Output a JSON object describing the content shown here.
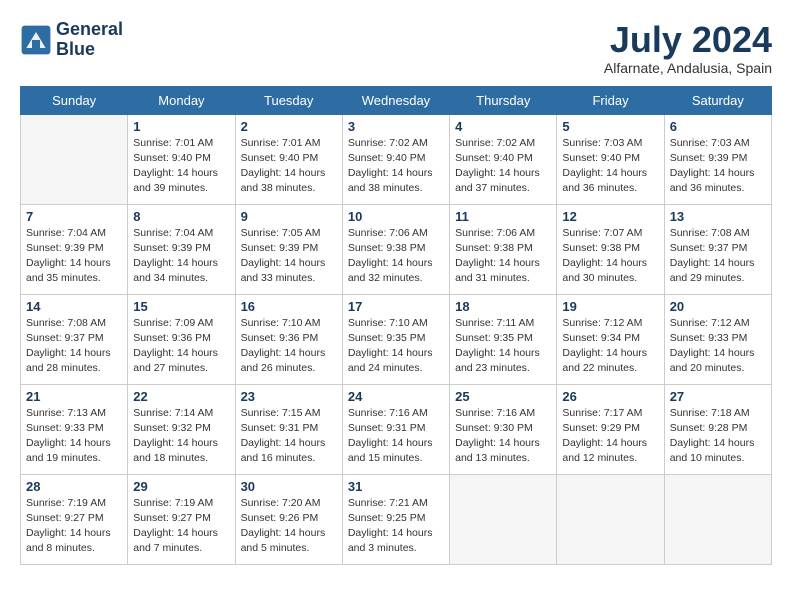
{
  "header": {
    "logo_line1": "General",
    "logo_line2": "Blue",
    "month_year": "July 2024",
    "location": "Alfarnate, Andalusia, Spain"
  },
  "days_of_week": [
    "Sunday",
    "Monday",
    "Tuesday",
    "Wednesday",
    "Thursday",
    "Friday",
    "Saturday"
  ],
  "weeks": [
    [
      {
        "day": "",
        "info": ""
      },
      {
        "day": "1",
        "info": "Sunrise: 7:01 AM\nSunset: 9:40 PM\nDaylight: 14 hours\nand 39 minutes."
      },
      {
        "day": "2",
        "info": "Sunrise: 7:01 AM\nSunset: 9:40 PM\nDaylight: 14 hours\nand 38 minutes."
      },
      {
        "day": "3",
        "info": "Sunrise: 7:02 AM\nSunset: 9:40 PM\nDaylight: 14 hours\nand 38 minutes."
      },
      {
        "day": "4",
        "info": "Sunrise: 7:02 AM\nSunset: 9:40 PM\nDaylight: 14 hours\nand 37 minutes."
      },
      {
        "day": "5",
        "info": "Sunrise: 7:03 AM\nSunset: 9:40 PM\nDaylight: 14 hours\nand 36 minutes."
      },
      {
        "day": "6",
        "info": "Sunrise: 7:03 AM\nSunset: 9:39 PM\nDaylight: 14 hours\nand 36 minutes."
      }
    ],
    [
      {
        "day": "7",
        "info": "Sunrise: 7:04 AM\nSunset: 9:39 PM\nDaylight: 14 hours\nand 35 minutes."
      },
      {
        "day": "8",
        "info": "Sunrise: 7:04 AM\nSunset: 9:39 PM\nDaylight: 14 hours\nand 34 minutes."
      },
      {
        "day": "9",
        "info": "Sunrise: 7:05 AM\nSunset: 9:39 PM\nDaylight: 14 hours\nand 33 minutes."
      },
      {
        "day": "10",
        "info": "Sunrise: 7:06 AM\nSunset: 9:38 PM\nDaylight: 14 hours\nand 32 minutes."
      },
      {
        "day": "11",
        "info": "Sunrise: 7:06 AM\nSunset: 9:38 PM\nDaylight: 14 hours\nand 31 minutes."
      },
      {
        "day": "12",
        "info": "Sunrise: 7:07 AM\nSunset: 9:38 PM\nDaylight: 14 hours\nand 30 minutes."
      },
      {
        "day": "13",
        "info": "Sunrise: 7:08 AM\nSunset: 9:37 PM\nDaylight: 14 hours\nand 29 minutes."
      }
    ],
    [
      {
        "day": "14",
        "info": "Sunrise: 7:08 AM\nSunset: 9:37 PM\nDaylight: 14 hours\nand 28 minutes."
      },
      {
        "day": "15",
        "info": "Sunrise: 7:09 AM\nSunset: 9:36 PM\nDaylight: 14 hours\nand 27 minutes."
      },
      {
        "day": "16",
        "info": "Sunrise: 7:10 AM\nSunset: 9:36 PM\nDaylight: 14 hours\nand 26 minutes."
      },
      {
        "day": "17",
        "info": "Sunrise: 7:10 AM\nSunset: 9:35 PM\nDaylight: 14 hours\nand 24 minutes."
      },
      {
        "day": "18",
        "info": "Sunrise: 7:11 AM\nSunset: 9:35 PM\nDaylight: 14 hours\nand 23 minutes."
      },
      {
        "day": "19",
        "info": "Sunrise: 7:12 AM\nSunset: 9:34 PM\nDaylight: 14 hours\nand 22 minutes."
      },
      {
        "day": "20",
        "info": "Sunrise: 7:12 AM\nSunset: 9:33 PM\nDaylight: 14 hours\nand 20 minutes."
      }
    ],
    [
      {
        "day": "21",
        "info": "Sunrise: 7:13 AM\nSunset: 9:33 PM\nDaylight: 14 hours\nand 19 minutes."
      },
      {
        "day": "22",
        "info": "Sunrise: 7:14 AM\nSunset: 9:32 PM\nDaylight: 14 hours\nand 18 minutes."
      },
      {
        "day": "23",
        "info": "Sunrise: 7:15 AM\nSunset: 9:31 PM\nDaylight: 14 hours\nand 16 minutes."
      },
      {
        "day": "24",
        "info": "Sunrise: 7:16 AM\nSunset: 9:31 PM\nDaylight: 14 hours\nand 15 minutes."
      },
      {
        "day": "25",
        "info": "Sunrise: 7:16 AM\nSunset: 9:30 PM\nDaylight: 14 hours\nand 13 minutes."
      },
      {
        "day": "26",
        "info": "Sunrise: 7:17 AM\nSunset: 9:29 PM\nDaylight: 14 hours\nand 12 minutes."
      },
      {
        "day": "27",
        "info": "Sunrise: 7:18 AM\nSunset: 9:28 PM\nDaylight: 14 hours\nand 10 minutes."
      }
    ],
    [
      {
        "day": "28",
        "info": "Sunrise: 7:19 AM\nSunset: 9:27 PM\nDaylight: 14 hours\nand 8 minutes."
      },
      {
        "day": "29",
        "info": "Sunrise: 7:19 AM\nSunset: 9:27 PM\nDaylight: 14 hours\nand 7 minutes."
      },
      {
        "day": "30",
        "info": "Sunrise: 7:20 AM\nSunset: 9:26 PM\nDaylight: 14 hours\nand 5 minutes."
      },
      {
        "day": "31",
        "info": "Sunrise: 7:21 AM\nSunset: 9:25 PM\nDaylight: 14 hours\nand 3 minutes."
      },
      {
        "day": "",
        "info": ""
      },
      {
        "day": "",
        "info": ""
      },
      {
        "day": "",
        "info": ""
      }
    ]
  ]
}
